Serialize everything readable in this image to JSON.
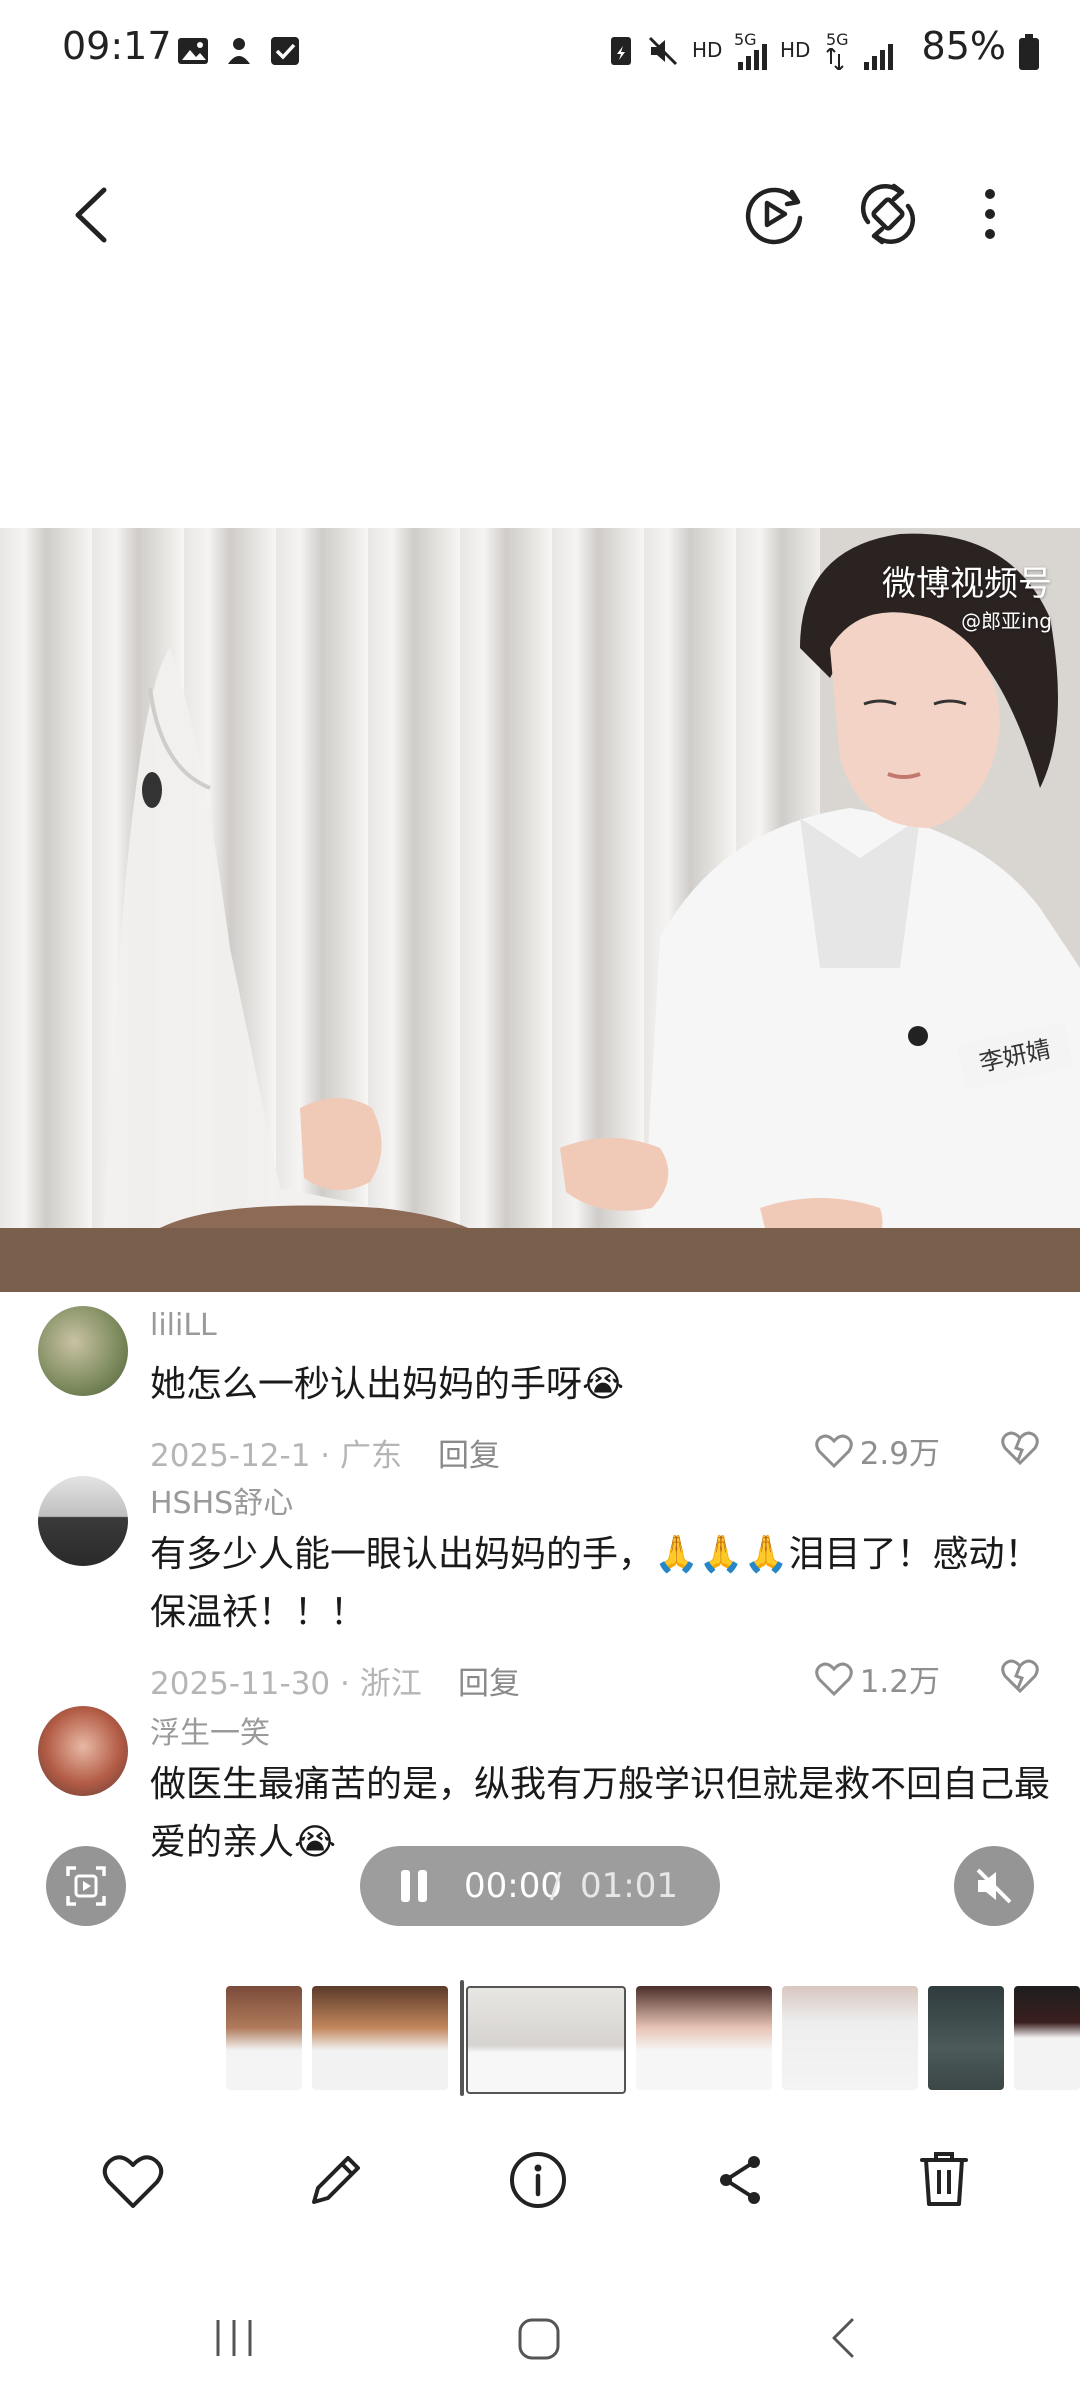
{
  "status_bar": {
    "time": "09:17",
    "network_1": "HD",
    "network_2": "HD",
    "signal_1": "5G",
    "signal_2": "5G",
    "battery": "85%"
  },
  "video": {
    "watermark": "微博视频号",
    "watermark_handle": "@郎亚ing",
    "name_badge": "李妍婧"
  },
  "comments": [
    {
      "username": "liliLL",
      "text": "她怎么一秒认出妈妈的手呀😭",
      "meta": "2025-12-1 · 广东",
      "reply": "回复",
      "likes": "2.9万"
    },
    {
      "username": "HSHS舒心",
      "text": "有多少人能一眼认出妈妈的手，🙏🙏🙏泪目了！感动！保温袄！！！",
      "meta": "2025-11-30 · 浙江",
      "reply": "回复",
      "likes": "1.2万"
    },
    {
      "username": "浮生一笑",
      "text": "做医生最痛苦的是，纵我有万般学识但就是救不回自己最爱的亲人😭",
      "meta": "",
      "reply": "",
      "likes": ""
    }
  ],
  "player": {
    "current_time": "00:00",
    "separator": "/",
    "total_time": "01:01"
  },
  "icons": {
    "back": "back-arrow-icon",
    "play_mode": "play-circle-icon",
    "rotate": "rotate-icon",
    "more": "more-vertical-icon",
    "capture": "screen-capture-icon",
    "mute": "mute-icon",
    "favorite": "heart-icon",
    "edit": "pencil-icon",
    "info": "info-icon",
    "share": "share-icon",
    "delete": "trash-icon"
  },
  "colors": {
    "accent": "#2a2a2a",
    "pill_bg": "#8c8c8c",
    "meta_text": "#b5b5b5"
  }
}
